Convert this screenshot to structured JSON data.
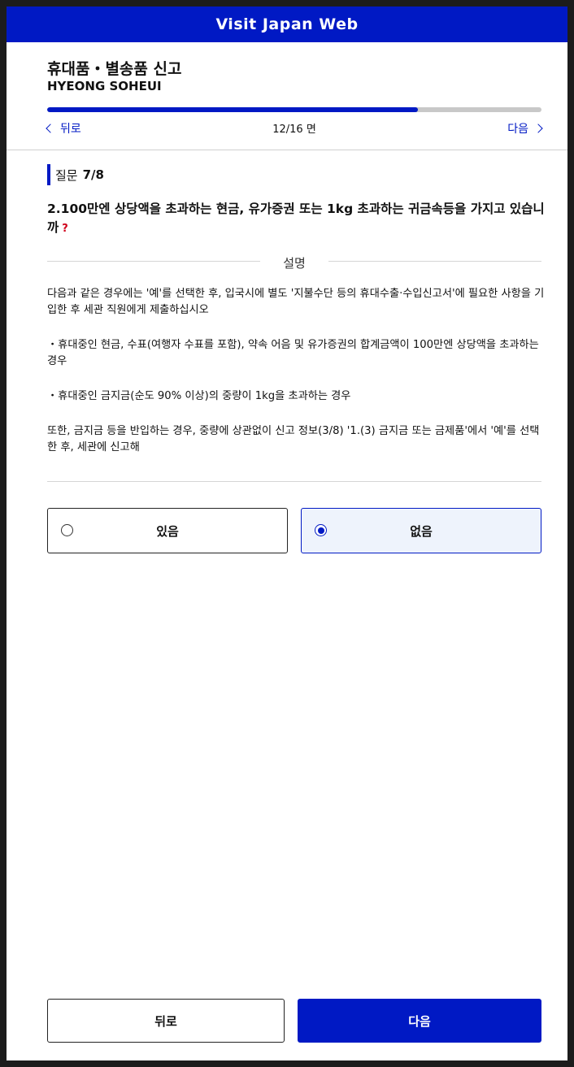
{
  "header": {
    "title": "Visit Japan Web"
  },
  "page": {
    "title": "휴대품・별송품 신고",
    "subtitle": "HYEONG SOHEUI"
  },
  "progress": {
    "fraction": 0.75,
    "back_label": "뒤로",
    "page_indicator": "12/16 면",
    "next_label": "다음"
  },
  "question": {
    "label": "질문",
    "number": "7/8",
    "text": "2.100만엔 상당액을 초과하는 현금, 유가증권 또는 1kg 초과하는 귀금속등을 가지고 있습니까",
    "help_mark": "?"
  },
  "explanation": {
    "title": "설명",
    "paragraphs": [
      "다음과 같은 경우에는 '예'를 선택한 후, 입국시에 별도 '지불수단 등의 휴대수출·수입신고서'에 필요한 사항을 기입한 후 세관 직원에게 제출하십시오",
      "・휴대중인 현금, 수표(여행자 수표를 포함), 약속 어음 및 유가증권의 합계금액이 100만엔 상당액을 초과하는 경우",
      "・휴대중인 금지금(순도 90% 이상)의 중량이 1kg을 초과하는 경우",
      "또한, 금지금 등을 반입하는 경우, 중량에 상관없이 신고 정보(3/8) '1.(3) 금지금 또는 금제품'에서 '예'를 선택한 후, 세관에 신고해"
    ]
  },
  "options": {
    "yes_label": "있음",
    "no_label": "없음",
    "selected": "없음"
  },
  "footer": {
    "back_button": "뒤로",
    "next_button": "다음"
  },
  "colors": {
    "brand": "#0019c4",
    "selected_bg": "#eef3fc",
    "help_mark": "#d0021b"
  }
}
